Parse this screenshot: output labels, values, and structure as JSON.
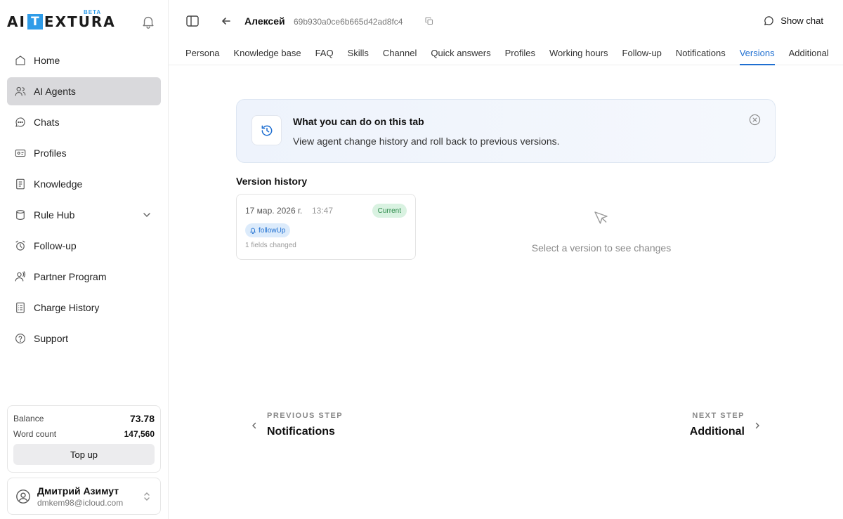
{
  "brand": {
    "logo_left": "AI",
    "logo_box": "T",
    "logo_right": "EXTURA",
    "badge": "BETA"
  },
  "sidebar": {
    "items": [
      {
        "label": "Home",
        "icon": "home-icon"
      },
      {
        "label": "AI Agents",
        "icon": "users-icon",
        "active": true
      },
      {
        "label": "Chats",
        "icon": "chat-bubble-icon"
      },
      {
        "label": "Profiles",
        "icon": "id-card-icon"
      },
      {
        "label": "Knowledge",
        "icon": "book-icon"
      },
      {
        "label": "Rule Hub",
        "icon": "cylinder-icon",
        "expandable": true
      },
      {
        "label": "Follow-up",
        "icon": "alarm-clock-icon"
      },
      {
        "label": "Partner Program",
        "icon": "partner-icon"
      },
      {
        "label": "Charge History",
        "icon": "receipt-icon"
      },
      {
        "label": "Support",
        "icon": "help-circle-icon"
      }
    ]
  },
  "balance": {
    "balance_label": "Balance",
    "balance_value": "73.78",
    "words_label": "Word count",
    "words_value": "147,560",
    "topup_label": "Top up"
  },
  "user": {
    "name": "Дмитрий Азимут",
    "email": "dmkem98@icloud.com"
  },
  "header": {
    "agent_name": "Алексей",
    "agent_id": "69b930a0ce6b665d42ad8fc4",
    "show_chat_label": "Show chat",
    "tabs": [
      "Persona",
      "Knowledge base",
      "FAQ",
      "Skills",
      "Channel",
      "Quick answers",
      "Profiles",
      "Working hours",
      "Follow-up",
      "Notifications",
      "Versions",
      "Additional"
    ],
    "active_tab": "Versions"
  },
  "info": {
    "title": "What you can do on this tab",
    "description": "View agent change history and roll back to previous versions."
  },
  "versions": {
    "section_title": "Version history",
    "items": [
      {
        "date": "17 мар. 2026 г.",
        "time": "13:47",
        "status": "Current",
        "tag": "followUp",
        "fields": "1 fields changed"
      }
    ],
    "empty_message": "Select a version to see changes"
  },
  "steps": {
    "prev_label": "PREVIOUS STEP",
    "prev_name": "Notifications",
    "next_label": "NEXT STEP",
    "next_name": "Additional"
  },
  "colors": {
    "accent": "#1f6fd1",
    "logo_blue": "#2f9ce8",
    "active_nav": "#d9d9dc",
    "current_badge": "#d9f2e1"
  }
}
